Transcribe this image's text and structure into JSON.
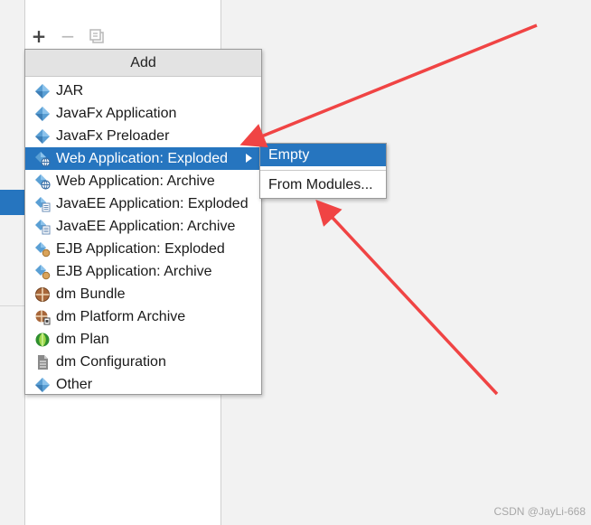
{
  "toolbar": {
    "add_icon": "plus-icon",
    "remove_icon": "minus-icon",
    "copy_icon": "copy-icon"
  },
  "menu": {
    "header": "Add",
    "items": [
      {
        "label": "JAR",
        "icon": "artifact-diamond-icon"
      },
      {
        "label": "JavaFx Application",
        "icon": "artifact-diamond-icon"
      },
      {
        "label": "JavaFx Preloader",
        "icon": "artifact-diamond-icon"
      },
      {
        "label": "Web Application: Exploded",
        "icon": "web-artifact-icon",
        "selected": true,
        "has_submenu": true
      },
      {
        "label": "Web Application: Archive",
        "icon": "web-artifact-icon"
      },
      {
        "label": "JavaEE Application: Exploded",
        "icon": "javaee-artifact-icon"
      },
      {
        "label": "JavaEE Application: Archive",
        "icon": "javaee-artifact-icon"
      },
      {
        "label": "EJB Application: Exploded",
        "icon": "ejb-artifact-icon"
      },
      {
        "label": "EJB Application: Archive",
        "icon": "ejb-artifact-icon"
      },
      {
        "label": "dm Bundle",
        "icon": "dm-bundle-icon"
      },
      {
        "label": "dm Platform Archive",
        "icon": "dm-platform-archive-icon"
      },
      {
        "label": "dm Plan",
        "icon": "dm-plan-icon"
      },
      {
        "label": "dm Configuration",
        "icon": "dm-configuration-icon"
      },
      {
        "label": "Other",
        "icon": "artifact-diamond-icon"
      }
    ]
  },
  "submenu": {
    "items": [
      {
        "label": "Empty",
        "selected": true
      },
      {
        "label": "From Modules..."
      }
    ]
  },
  "watermark": "CSDN @JayLi-668",
  "colors": {
    "selection": "#2675bf",
    "annotation_arrow": "#f04444",
    "menu_header_bg": "#e3e3e3",
    "background": "#f2f2f2"
  }
}
